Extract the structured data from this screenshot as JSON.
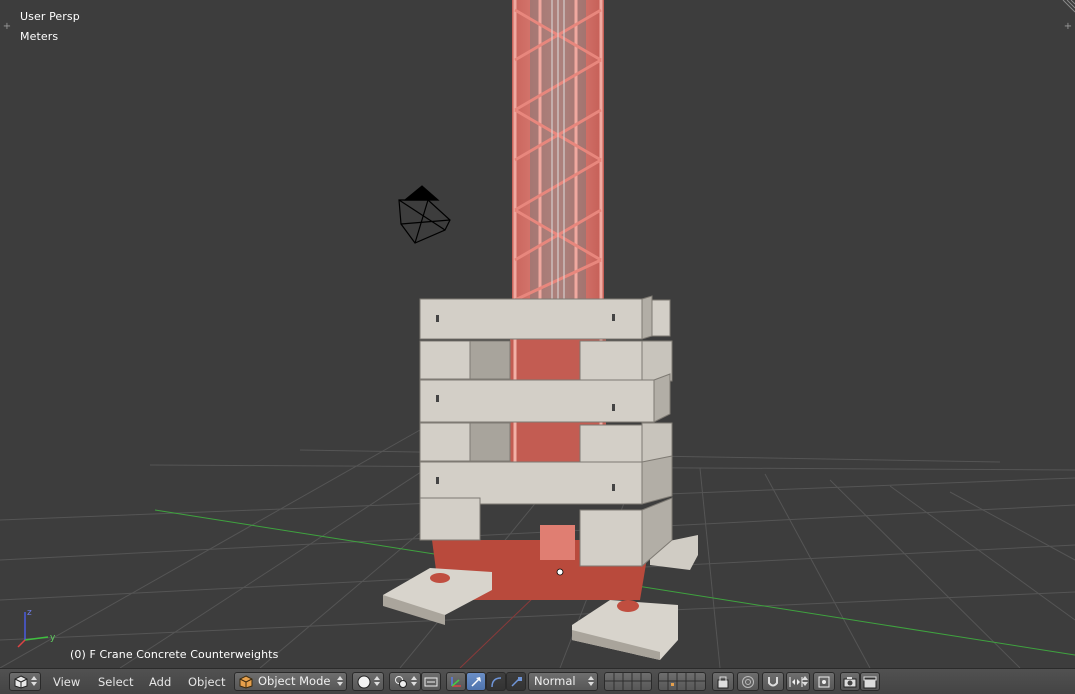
{
  "viewport": {
    "view_name": "User Persp",
    "units": "Meters",
    "object_info": "(0) F Crane Concrete Counterweights",
    "axis_labels": {
      "z": "z",
      "y": "y"
    }
  },
  "header": {
    "menus": {
      "view": "View",
      "select": "Select",
      "add": "Add",
      "object": "Object"
    },
    "mode": "Object Mode",
    "orientation": "Normal"
  },
  "colors": {
    "viewport_bg": "#3d3d3d",
    "grid": "#545454",
    "x_axis": "#b23a3a",
    "y_axis": "#3fa33f",
    "crane_red": "#d9736b",
    "crane_dark_red": "#b84c3e",
    "concrete": "#d3cfc7",
    "header_bg": "#4a4a4a",
    "active_blue": "#5680c2"
  }
}
